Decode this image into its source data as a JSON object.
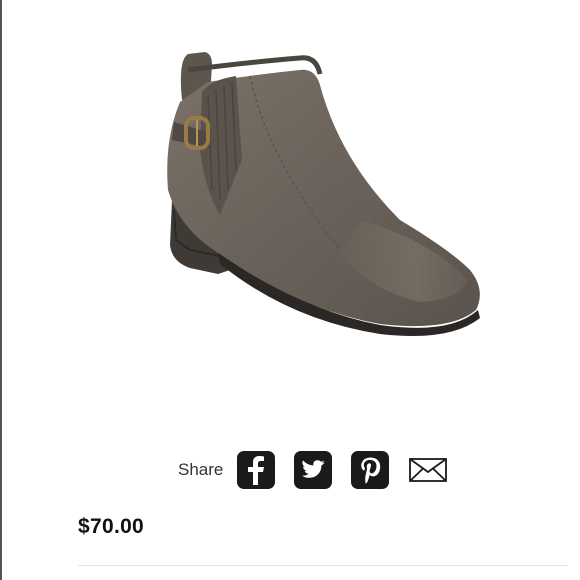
{
  "product": {
    "image_label": "boot-photo",
    "price": "$70.00"
  },
  "share": {
    "label": "Share",
    "icons": [
      "facebook-icon",
      "twitter-icon",
      "pinterest-icon",
      "email-icon"
    ]
  },
  "colors": {
    "icon_bg": "#1a1a1a",
    "boot_main": "#6f665d",
    "boot_dark": "#3b3632",
    "sole": "#2b2724",
    "buckle": "#9a7a45"
  }
}
